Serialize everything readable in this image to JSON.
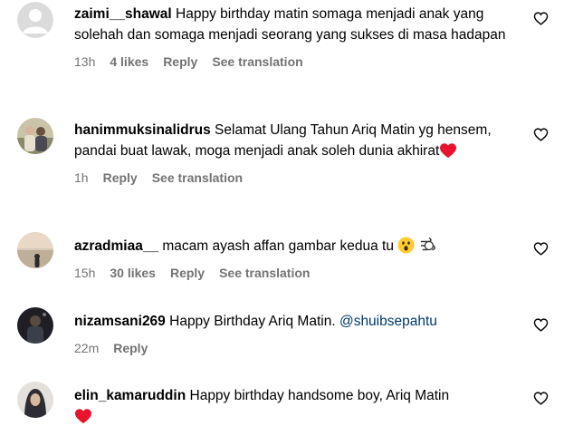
{
  "comments": [
    {
      "username": "zaimi__shawal",
      "text": "Happy birthday matin somaga menjadi anak yang solehah dan somaga menjadi seorang yang sukses di masa hadapan",
      "time": "13h",
      "likes": "4 likes",
      "reply": "Reply",
      "translate": "See translation"
    },
    {
      "username": "hanimmuksinalidrus",
      "text": "Selamat Ulang Tahun Ariq Matin yg hensem, pandai buat lawak, moga menjadi anak soleh dunia akhirat",
      "time": "1h",
      "reply": "Reply",
      "translate": "See translation"
    },
    {
      "username": "azradmiaa__",
      "text": "macam ayash affan gambar kedua tu",
      "time": "15h",
      "likes": "30 likes",
      "reply": "Reply",
      "translate": "See translation"
    },
    {
      "username": "nizamsani269",
      "text": "Happy Birthday Ariq Matin.",
      "mention": "@shuibsepahtu",
      "time": "22m",
      "reply": "Reply"
    },
    {
      "username": "elin_kamaruddin",
      "text": "Happy birthday handsome boy, Ariq Matin",
      "time": ""
    }
  ],
  "icons": {
    "heart_outline": "heart-icon",
    "red_heart": "red-heart-emoji",
    "astonished": "astonished-face-emoji",
    "wind": "wind-face-emoji"
  },
  "colors": {
    "meta": "#737373",
    "mention": "#00376b",
    "red_heart": "#e8132d"
  }
}
